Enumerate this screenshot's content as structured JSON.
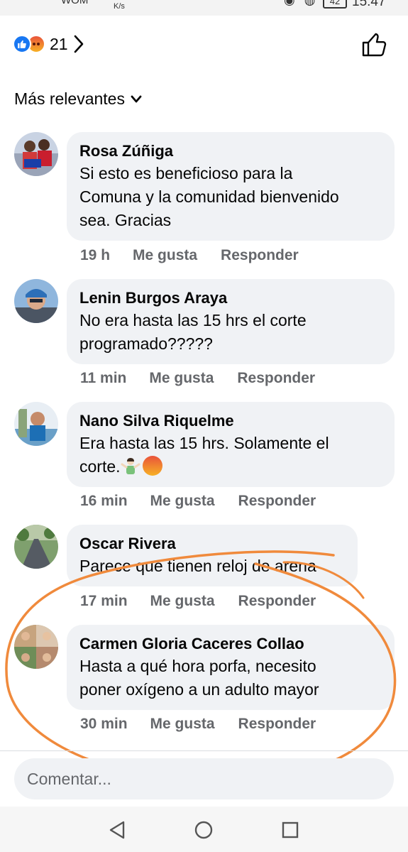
{
  "status_bar": {
    "carrier": "WOM",
    "speed": "K/s",
    "battery": "42",
    "time": "15:47"
  },
  "reactions": {
    "count": "21",
    "types": [
      "like-icon",
      "angry-icon"
    ]
  },
  "sort": {
    "label": "Más relevantes"
  },
  "comments": [
    {
      "author": "Rosa Zúñiga",
      "lines": [
        "Si esto es beneficioso para la",
        "Comuna y la comunidad bienvenido",
        "sea. Gracias"
      ],
      "time": "19 h",
      "like": "Me gusta",
      "reply": "Responder"
    },
    {
      "author": "Lenin Burgos Araya",
      "lines": [
        "No era hasta las 15 hrs el corte",
        "programado?????"
      ],
      "time": "11 min",
      "like": "Me gusta",
      "reply": "Responder"
    },
    {
      "author": "Nano Silva Riquelme",
      "lines": [
        "Era hasta las 15 hrs. Solamente el",
        "corte."
      ],
      "emojis": [
        "person-shrugging-icon",
        "angry-face-icon"
      ],
      "time": "16 min",
      "like": "Me gusta",
      "reply": "Responder"
    },
    {
      "author": "Oscar Rivera",
      "lines": [
        "Parece que tienen reloj de arena"
      ],
      "time": "17 min",
      "like": "Me gusta",
      "reply": "Responder"
    },
    {
      "author": "Carmen Gloria Caceres Collao",
      "lines": [
        "Hasta a qué hora porfa, necesito",
        "poner oxígeno a un adulto mayor"
      ],
      "time": "30 min",
      "like": "Me gusta",
      "reply": "Responder"
    }
  ],
  "composer": {
    "placeholder": "Comentar..."
  },
  "colors": {
    "bubble": "#f0f2f5",
    "meta_text": "#65676b",
    "like_blue": "#1877f2",
    "annotation_orange": "#f08a3c"
  },
  "navigation": [
    "back-icon",
    "home-icon",
    "recents-icon"
  ]
}
